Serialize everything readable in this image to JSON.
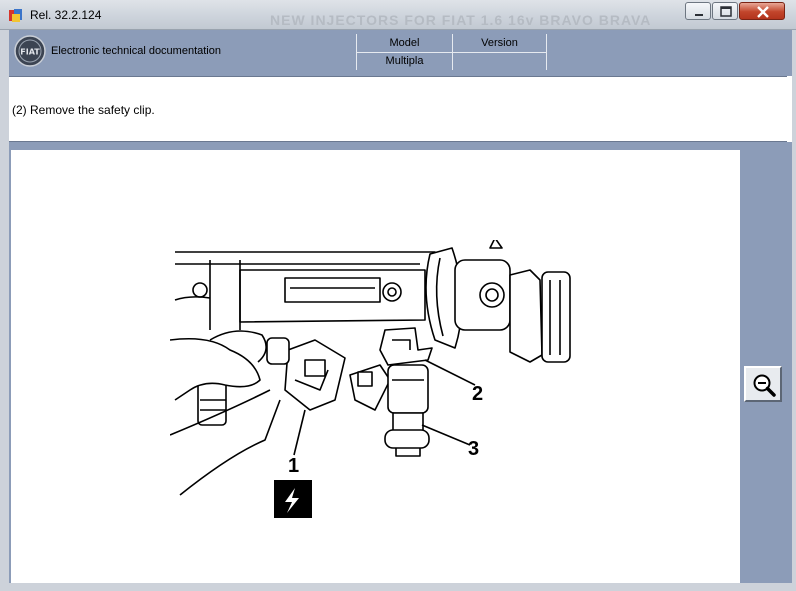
{
  "window": {
    "title": "Rel. 32.2.124",
    "faded_title": "NEW INJECTORS FOR FIAT 1.6 16v BRAVO BRAVA"
  },
  "header": {
    "doc_label": "Electronic technical documentation",
    "col_model": "Model",
    "col_version": "Version",
    "model_value": "Multipla",
    "version_value": ""
  },
  "instruction": {
    "text": "(2) Remove the safety clip."
  },
  "figure": {
    "callouts": [
      "1",
      "2",
      "3"
    ]
  },
  "icons": {
    "logo": "fiat-logo",
    "zoom": "zoom-out-magnifier-icon",
    "warning": "electric-warning-icon"
  }
}
